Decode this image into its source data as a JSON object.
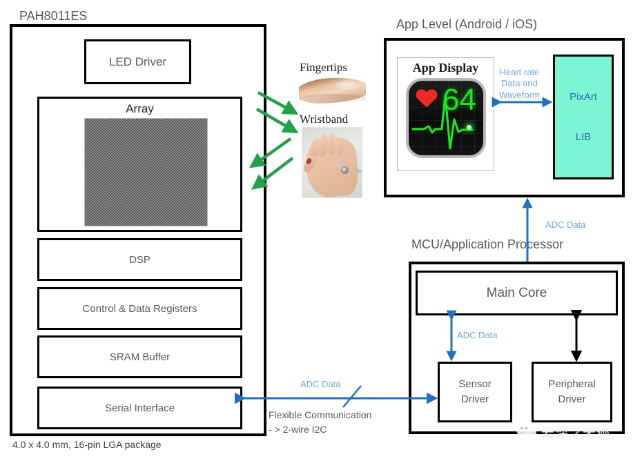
{
  "chip": {
    "title": "PAH8011ES",
    "blocks": [
      {
        "id": "led-driver",
        "label": "LED Driver"
      },
      {
        "id": "array",
        "label": "Array"
      },
      {
        "id": "dsp",
        "label": "DSP"
      },
      {
        "id": "control",
        "label": "Control & Data Registers"
      },
      {
        "id": "sram",
        "label": "SRAM Buffer"
      },
      {
        "id": "serial",
        "label": "Serial Interface"
      }
    ],
    "package_note": "4.0 x 4.0 mm, 16-pin LGA package"
  },
  "sensing": {
    "fingertips_label": "Fingertips",
    "wristband_label": "Wristband"
  },
  "app_level": {
    "title": "App Level (Android / iOS)",
    "display_title": "App Display",
    "heart_rate_value": "64",
    "flow_label": "Heart rate\nData and\nWaveform",
    "flow_label_lines": [
      "Heart rate",
      "Data and",
      "Waveform"
    ],
    "lib_name": "PixArt",
    "lib_suffix": "LIB"
  },
  "mcu": {
    "title": "MCU/Application Processor",
    "main_core": "Main Core",
    "sensor_driver_lines": [
      "Sensor",
      "Driver"
    ],
    "peripheral_driver_lines": [
      "Peripheral",
      "Driver"
    ],
    "adc_internal_label": "ADC Data",
    "adc_uplink_label": "ADC Data"
  },
  "bus": {
    "adc_label": "ADC Data",
    "comm_line1": "Flexible Communication",
    "comm_line2": "- > 2-wire I2C"
  },
  "watermark": {
    "text": "云深之无迹"
  },
  "colors": {
    "outline": "#000000",
    "text_gray": "#595959",
    "blue_arrow": "#1f6fc4",
    "blue_label": "#6fa8dc",
    "green_arrow": "#21a149",
    "lib_fill": "#7cf5d5",
    "lib_text": "#2e6fa8",
    "hr_green": "#19e81c",
    "heart_red": "#ee2a26"
  }
}
